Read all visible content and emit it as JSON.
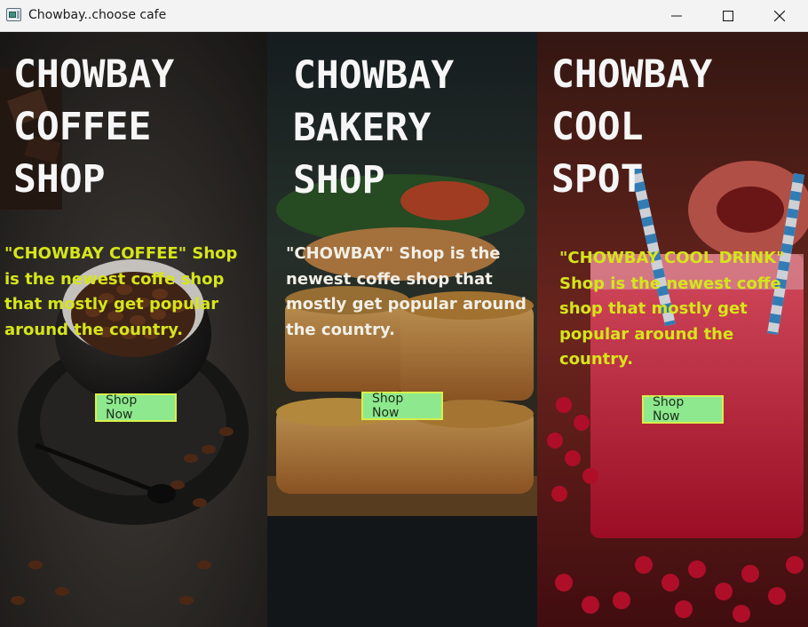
{
  "window": {
    "title": "Chowbay..choose cafe",
    "controls": [
      "minimize-icon",
      "maximize-icon",
      "close-icon"
    ]
  },
  "panels": [
    {
      "heading_lines": [
        "CHOWBAY",
        "COFFEE",
        "SHOP"
      ],
      "description": "\"CHOWBAY  COFFEE\" Shop is the  newest coffe shop that mostly get popular around the country.",
      "description_color": "#d6e51a",
      "button_label": "Shop Now",
      "image": "coffee-cup-with-beans"
    },
    {
      "heading_lines": [
        "CHOWBAY",
        "BAKERY",
        "SHOP"
      ],
      "description": "\"CHOWBAY\" Shop is the newest coffe shop that mostly get popular around the country.",
      "description_color": "#f1efe6",
      "button_label": "Shop Now",
      "image": "stacked-tarts"
    },
    {
      "heading_lines": [
        "CHOWBAY",
        "COOL",
        "SPOT"
      ],
      "description": "\"CHOWBAY  COOL DRINK\" Shop is the  newest coffe shop that mostly get popular around the country.",
      "description_color": "#d6e51a",
      "button_label": "Shop Now",
      "image": "pomegranate-drink"
    }
  ],
  "colors": {
    "button_bg": "#8ee88e",
    "button_border": "#d8ef4a",
    "heading": "#f6f6f6"
  }
}
